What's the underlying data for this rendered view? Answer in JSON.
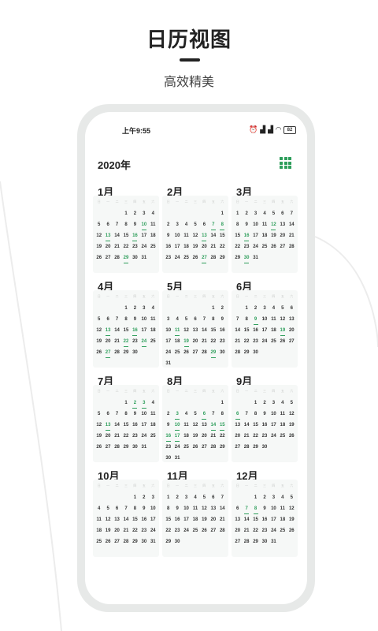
{
  "promo": {
    "title": "日历视图",
    "subtitle": "高效精美"
  },
  "status_bar": {
    "time": "上午9:55",
    "battery": "82"
  },
  "header": {
    "year": "2020年",
    "grid_icon": "grid-view-icon"
  },
  "weekday_labels": [
    "日",
    "一",
    "二",
    "三",
    "四",
    "五",
    "六"
  ],
  "colors": {
    "accent": "#2e9e5b",
    "card": "#f6f8f7",
    "phone_frame": "#e7e9e8"
  },
  "months": [
    {
      "name": "1月",
      "start": 3,
      "days": 31,
      "highlights": [
        10,
        13,
        16,
        29
      ]
    },
    {
      "name": "2月",
      "start": 6,
      "days": 29,
      "highlights": [
        7,
        8,
        13,
        27
      ]
    },
    {
      "name": "3月",
      "start": 0,
      "days": 31,
      "highlights": [
        12,
        16,
        30
      ]
    },
    {
      "name": "4月",
      "start": 3,
      "days": 30,
      "highlights": [
        13,
        16,
        22,
        24,
        27
      ]
    },
    {
      "name": "5月",
      "start": 5,
      "days": 31,
      "highlights": [
        11,
        19,
        29
      ]
    },
    {
      "name": "6月",
      "start": 1,
      "days": 30,
      "highlights": [
        9,
        19
      ]
    },
    {
      "name": "7月",
      "start": 3,
      "days": 31,
      "highlights": [
        2,
        3,
        13
      ]
    },
    {
      "name": "8月",
      "start": 6,
      "days": 31,
      "highlights": [
        3,
        6,
        10,
        14,
        15,
        16,
        17
      ]
    },
    {
      "name": "9月",
      "start": 2,
      "days": 30,
      "highlights": [
        6
      ]
    },
    {
      "name": "10月",
      "start": 4,
      "days": 31,
      "highlights": []
    },
    {
      "name": "11月",
      "start": 0,
      "days": 30,
      "highlights": []
    },
    {
      "name": "12月",
      "start": 2,
      "days": 31,
      "highlights": [
        7,
        8
      ]
    }
  ]
}
